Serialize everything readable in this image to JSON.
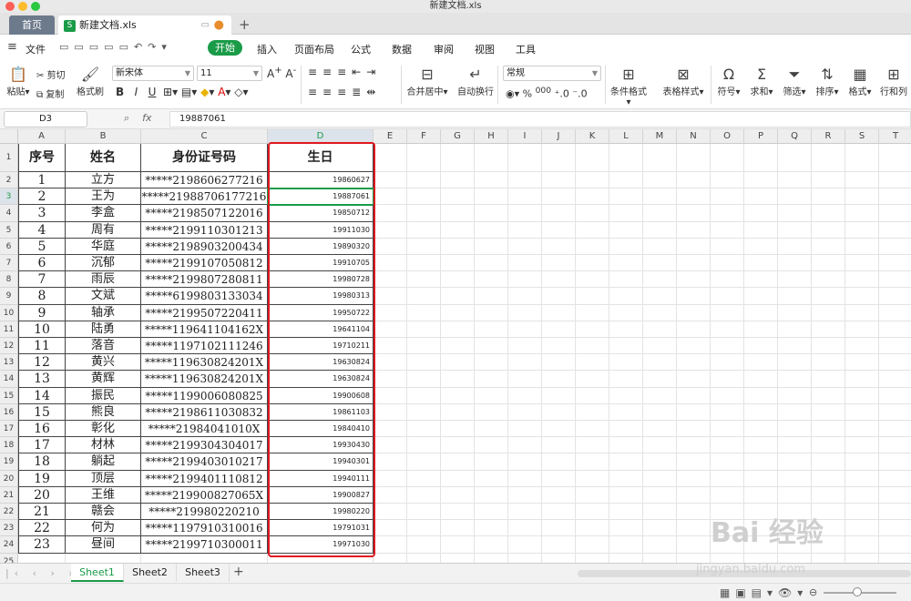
{
  "window": {
    "title": "新建文档.xls"
  },
  "tabs": {
    "home": "首页",
    "file": "新建文档.xls",
    "add": "+"
  },
  "menu": {
    "file": "文件",
    "start": "开始",
    "items": [
      "插入",
      "页面布局",
      "公式",
      "数据",
      "审阅",
      "视图",
      "工具"
    ]
  },
  "ribbon": {
    "paste": "粘贴",
    "cut": "剪切",
    "copy": "复制",
    "format_painter": "格式刷",
    "font_name": "新宋体",
    "font_size": "11",
    "bold": "B",
    "italic": "I",
    "underline": "U",
    "merge": "合并居中",
    "wrap": "自动换行",
    "number_format": "常规",
    "cond_format": "条件格式",
    "table_style": "表格样式",
    "symbol": "符号",
    "sum": "求和",
    "filter": "筛选",
    "sort": "排序",
    "format": "格式",
    "rowcol": "行和列",
    "percent": "%",
    "thousands": "000"
  },
  "formula_bar": {
    "name_box": "D3",
    "fx": "fx",
    "value": "19887061"
  },
  "columns": [
    "A",
    "B",
    "C",
    "D",
    "E",
    "F",
    "G",
    "H",
    "I",
    "J",
    "K",
    "L",
    "M",
    "N",
    "O",
    "P",
    "Q",
    "R",
    "S",
    "T"
  ],
  "active_cell": "D3",
  "table": {
    "headers": [
      "序号",
      "姓名",
      "身份证号码",
      "生日"
    ],
    "rows": [
      [
        "1",
        "立方",
        "*****2198606277216",
        "19860627"
      ],
      [
        "2",
        "王为",
        "*****21988706177216",
        "19887061"
      ],
      [
        "3",
        "李盒",
        "*****2198507122016",
        "19850712"
      ],
      [
        "4",
        "周有",
        "*****2199110301213",
        "19911030"
      ],
      [
        "5",
        "华庭",
        "*****2198903200434",
        "19890320"
      ],
      [
        "6",
        "沉郁",
        "*****2199107050812",
        "19910705"
      ],
      [
        "7",
        "雨辰",
        "*****2199807280811",
        "19980728"
      ],
      [
        "8",
        "文斌",
        "*****6199803133034",
        "19980313"
      ],
      [
        "9",
        "轴承",
        "*****2199507220411",
        "19950722"
      ],
      [
        "10",
        "陆勇",
        "*****119641104162X",
        "19641104"
      ],
      [
        "11",
        "落音",
        "*****1197102111246",
        "19710211"
      ],
      [
        "12",
        "黄兴",
        "*****119630824201X",
        "19630824"
      ],
      [
        "13",
        "黄辉",
        "*****119630824201X",
        "19630824"
      ],
      [
        "14",
        "振民",
        "*****1199006080825",
        "19900608"
      ],
      [
        "15",
        "熊良",
        "*****2198611030832",
        "19861103"
      ],
      [
        "16",
        "彰化",
        "*****21984041010X",
        "19840410"
      ],
      [
        "17",
        "材林",
        "*****2199304304017",
        "19930430"
      ],
      [
        "18",
        "躺起",
        "*****2199403010217",
        "19940301"
      ],
      [
        "19",
        "顶层",
        "*****2199401110812",
        "19940111"
      ],
      [
        "20",
        "王维",
        "*****219900827065X",
        "19900827"
      ],
      [
        "21",
        "赣会",
        "*****219980220210",
        "19980220"
      ],
      [
        "22",
        "何为",
        "*****1197910310016",
        "19791031"
      ],
      [
        "23",
        "昼间",
        "*****2199710300011",
        "19971030"
      ]
    ]
  },
  "sheets": [
    "Sheet1",
    "Sheet2",
    "Sheet3"
  ],
  "watermark": {
    "brand": "Bai 经验",
    "url": "jingyan.baidu.com"
  },
  "colors": {
    "accent": "#1a9b48",
    "highlight_box": "#e0171f"
  }
}
